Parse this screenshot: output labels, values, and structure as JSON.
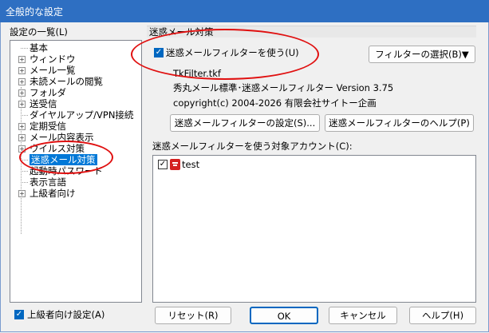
{
  "window": {
    "title": "全般的な設定"
  },
  "left": {
    "list_label": "設定の一覧(L)",
    "items": [
      {
        "label": "基本"
      },
      {
        "label": "ウィンドウ"
      },
      {
        "label": "メール一覧"
      },
      {
        "label": "未読メールの閲覧"
      },
      {
        "label": "フォルダ"
      },
      {
        "label": "送受信"
      },
      {
        "label": "ダイヤルアップ/VPN接続"
      },
      {
        "label": "定期受信"
      },
      {
        "label": "メール内容表示"
      },
      {
        "label": "ウイルス対策"
      },
      {
        "label": "迷惑メール対策"
      },
      {
        "label": "起動時パスワード"
      },
      {
        "label": "表示言語"
      },
      {
        "label": "上級者向け"
      }
    ],
    "advanced_checkbox": "上級者向け設定(A)"
  },
  "main": {
    "section_title": "迷惑メール対策",
    "use_filter_checkbox": "迷惑メールフィルターを使う(U)",
    "select_filter_button": "フィルターの選択(B)▼",
    "filter_file": "TkFilter.tkf",
    "filter_name": "秀丸メール標準･迷惑メールフィルター Version 3.75",
    "copyright": "copyright(c) 2004-2026 有限会社サイトー企画",
    "settings_button": "迷惑メールフィルターの設定(S)...",
    "help_button": "迷惑メールフィルターのヘルプ(P)",
    "accounts_label": "迷惑メールフィルターを使う対象アカウント(C):",
    "accounts": [
      {
        "name": "test"
      }
    ]
  },
  "footer": {
    "reset": "リセット(R)",
    "ok": "OK",
    "cancel": "キャンセル",
    "help": "ヘルプ(H)"
  },
  "colors": {
    "title_bar": "#2e6fc2",
    "selection": "#0078d7",
    "annotation": "#e01010"
  }
}
